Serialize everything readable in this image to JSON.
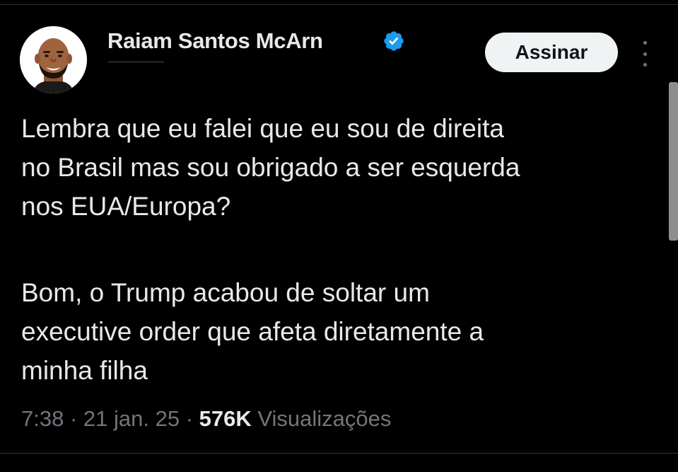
{
  "author": {
    "name": "Raiam Santos McArn",
    "verified": true
  },
  "actions": {
    "subscribe_label": "Assinar",
    "more_icon": "more-vertical-icon"
  },
  "tweet": {
    "paragraph_1": "Lembra que eu falei que eu sou de direita\nno Brasil mas sou obrigado a ser esquerda\nnos EUA/Europa?",
    "paragraph_2": "Bom, o Trump acabou de soltar um\nexecutive order que afeta diretamente a\nminha filha"
  },
  "meta": {
    "time": "7:38",
    "separator": "·",
    "date": "21 jan. 25",
    "views_count": "576K",
    "views_label": "Visualizações"
  },
  "colors": {
    "background": "#000000",
    "text": "#e7e9ea",
    "secondary_text": "#71767b",
    "verified_badge": "#1d9bf0",
    "button_bg": "#eff3f4"
  }
}
